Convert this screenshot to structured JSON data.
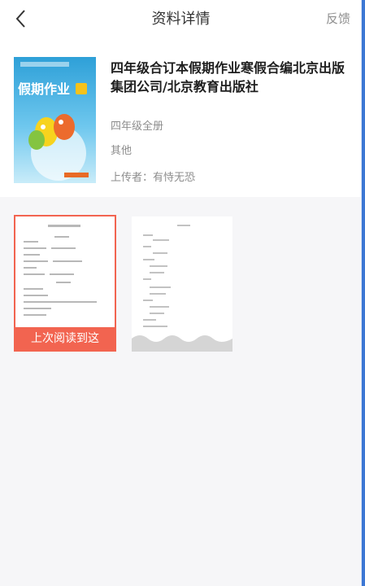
{
  "header": {
    "title": "资料详情",
    "feedback_label": "反馈"
  },
  "book": {
    "title": "四年级合订本假期作业寒假合编北京出版集团公司/北京教育出版社",
    "grade": "四年级全册",
    "type": "其他",
    "uploader": "上传者：有恃无恐",
    "cover_title": "假期作业"
  },
  "pages": {
    "last_read_label": "上次阅读到这"
  },
  "colors": {
    "accent": "#f26450",
    "cover_blue": "#2ea0d8",
    "edge_blue": "#3c77d4"
  }
}
